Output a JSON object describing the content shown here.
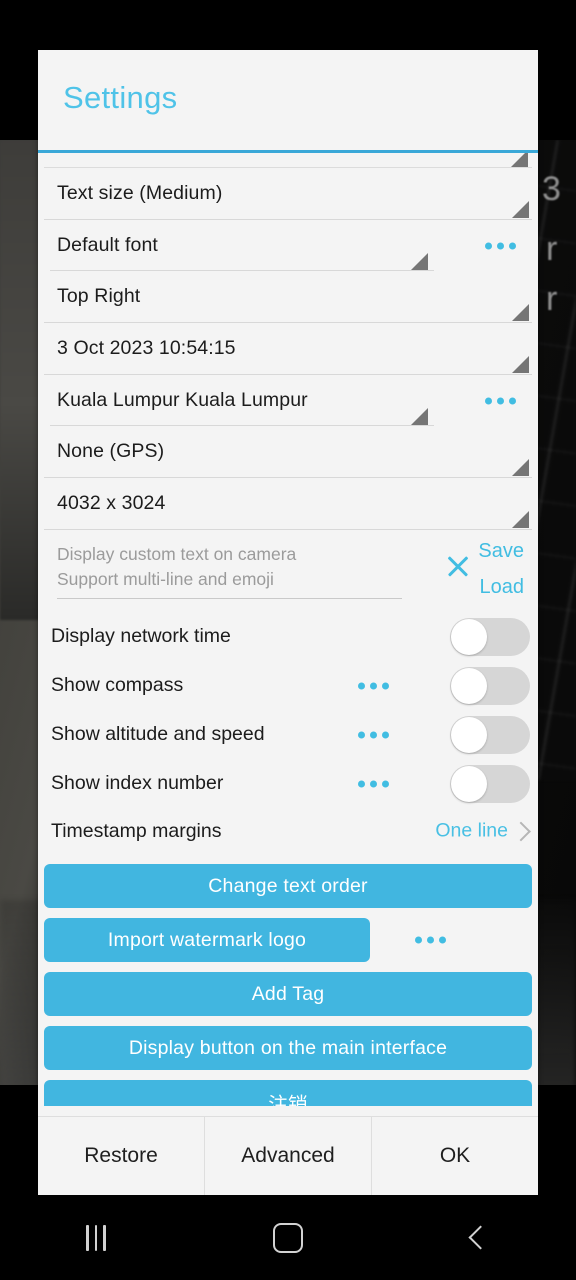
{
  "app": {
    "dialog_title": "Settings",
    "accent_blue": "#41bde2",
    "title_blue": "#4fc3e8",
    "button_blue": "#41b6e0",
    "dialog_bg": "#f4f4f4"
  },
  "spinners": [
    {
      "value": "Text size (Medium)",
      "has_kebab": false
    },
    {
      "value": "Default font",
      "has_kebab": true
    },
    {
      "value": "Top Right",
      "has_kebab": false
    },
    {
      "value": "3 Oct 2023 10:54:15",
      "has_kebab": false
    },
    {
      "value": "Kuala Lumpur Kuala Lumpur",
      "has_kebab": true
    },
    {
      "value": "None (GPS)",
      "has_kebab": false
    },
    {
      "value": "4032 x 3024",
      "has_kebab": false
    }
  ],
  "custom_text": {
    "placeholder_line1": "Display custom text on camera",
    "placeholder_line2": "Support multi-line and emoji",
    "value": "",
    "clear_icon": "close-icon",
    "save_label": "Save",
    "load_label": "Load"
  },
  "toggles": [
    {
      "label": "Display network time",
      "has_kebab": false,
      "on": false
    },
    {
      "label": "Show compass",
      "has_kebab": true,
      "on": false
    },
    {
      "label": "Show altitude and speed",
      "has_kebab": true,
      "on": false
    },
    {
      "label": "Show index number",
      "has_kebab": true,
      "on": false
    }
  ],
  "timestamp_margins": {
    "label": "Timestamp margins",
    "value": "One line",
    "chevron": "chevron-right-icon"
  },
  "buttons": [
    {
      "label": "Change text order",
      "width": "wide",
      "has_kebab": false
    },
    {
      "label": "Import watermark logo",
      "width": "narrow",
      "has_kebab": true
    },
    {
      "label": "Add Tag",
      "width": "wide",
      "has_kebab": false
    },
    {
      "label": "Display button on the main interface",
      "width": "wide",
      "has_kebab": false
    },
    {
      "label": "注销",
      "width": "wide",
      "has_kebab": false
    }
  ],
  "footer": {
    "restore_label": "Restore",
    "advanced_label": "Advanced",
    "ok_label": "OK"
  },
  "navbar": {
    "recents": "recents-icon",
    "home": "home-icon",
    "back": "back-icon"
  },
  "backdrop": {
    "ghost_text_1": "3",
    "ghost_text_2": "r",
    "ghost_text_3": "r"
  }
}
